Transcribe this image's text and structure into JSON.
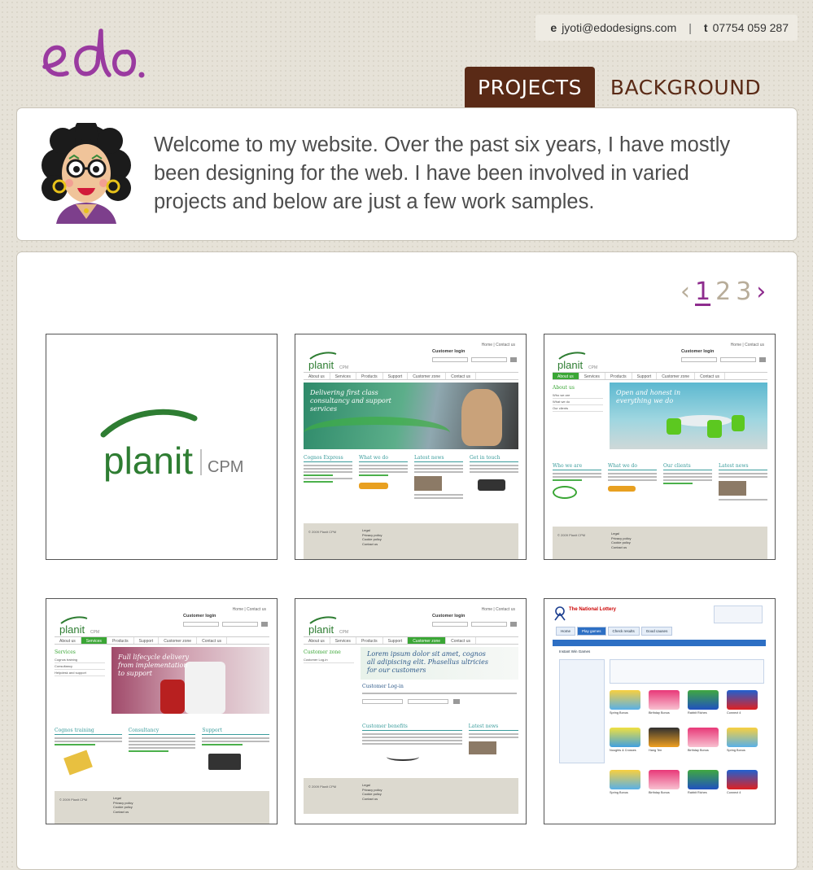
{
  "brand": {
    "logo_text": "edo."
  },
  "contact": {
    "email_label": "e",
    "email": "jyoti@edodesigns.com",
    "separator": "|",
    "phone_label": "t",
    "phone": "07754 059 287"
  },
  "nav": {
    "projects_label": "PROJECTS",
    "background_label": "BACKGROUND"
  },
  "welcome": {
    "text": "Welcome to my website. Over the past six years, I have mostly been designing for the web. I have been involved in varied projects and below are just a few work samples."
  },
  "pagination": {
    "prev_icon": "chevron-left-icon",
    "next_icon": "chevron-right-icon",
    "pages": [
      "1",
      "2",
      "3"
    ],
    "current": "1"
  },
  "thumbnails": [
    {
      "kind": "logo",
      "logo_main": "planit",
      "logo_sub": "CPM"
    },
    {
      "kind": "site",
      "logo_main": "planit",
      "logo_sub": "CPM",
      "top_links": "Home  |  Contact us",
      "login_label": "Customer login",
      "nav": [
        "About us",
        "Services",
        "Products",
        "Support",
        "Customer zone",
        "Contact us"
      ],
      "active_nav": "",
      "hero_caption": "Delivering first class consultancy and support services",
      "columns": [
        "Cognos Express",
        "What we do",
        "Latest news",
        "Get in touch"
      ],
      "footer_left": "© 2009 Planit CPM",
      "footer_links": [
        "Legal",
        "Privacy policy",
        "Cookie policy",
        "Contact us"
      ]
    },
    {
      "kind": "site-side",
      "logo_main": "planit",
      "logo_sub": "CPM",
      "top_links": "Home  |  Contact us",
      "login_label": "Customer login",
      "nav": [
        "About us",
        "Services",
        "Products",
        "Support",
        "Customer zone",
        "Contact us"
      ],
      "active_nav": "About us",
      "side_title": "About us",
      "side_items": [
        "Who we are",
        "What we do",
        "Our clients"
      ],
      "hero_caption": "Open and honest in everything we do",
      "columns": [
        "Who we are",
        "What we do",
        "Our clients",
        "Latest news"
      ],
      "footer_left": "© 2009 Planit CPM",
      "footer_links": [
        "Legal",
        "Privacy policy",
        "Cookie policy",
        "Contact us"
      ]
    },
    {
      "kind": "site-side",
      "logo_main": "planit",
      "logo_sub": "CPM",
      "top_links": "Home  |  Contact us",
      "login_label": "Customer login",
      "nav": [
        "About us",
        "Services",
        "Products",
        "Support",
        "Customer zone",
        "Contact us"
      ],
      "active_nav": "Services",
      "side_title": "Services",
      "side_items": [
        "Cognos training",
        "Consultancy",
        "Helpdesk and support"
      ],
      "hero_caption": "Full lifecycle delivery from implementation to support",
      "columns": [
        "Cognos training",
        "Consultancy",
        "Support"
      ],
      "footer_left": "© 2009 Planit CPM",
      "footer_links": [
        "Legal",
        "Privacy policy",
        "Cookie policy",
        "Contact us"
      ]
    },
    {
      "kind": "site-side",
      "logo_main": "planit",
      "logo_sub": "CPM",
      "top_links": "Home  |  Contact us",
      "login_label": "Customer login",
      "nav": [
        "About us",
        "Services",
        "Products",
        "Support",
        "Customer zone",
        "Contact us"
      ],
      "active_nav": "Customer zone",
      "side_title": "Customer zone",
      "side_items": [
        "Customer Log-in"
      ],
      "hero_caption": "Lorem ipsum dolor sit amet, cognos all adipiscing elit. Phasellus ultricies for our customers",
      "columns": [
        "Customer benefits",
        "Latest news"
      ],
      "footer_left": "© 2009 Planit CPM",
      "footer_links": [
        "Legal",
        "Privacy policy",
        "Cookie policy",
        "Contact us"
      ]
    },
    {
      "kind": "lottery",
      "title": "The National Lottery",
      "tabs": [
        "Home",
        "Play games",
        "Check results",
        "Good causes"
      ],
      "active_tab": "Play games",
      "section": "Instant Win Games",
      "games": [
        "Spring Bonus",
        "Birthday Bonus",
        "Rabbit Riches",
        "Connect 4",
        "Noughts & Crosses",
        "Hang Ten",
        "Birthday Bonus",
        "Spring Bonus",
        "Spring Bonus",
        "Birthday Bonus",
        "Rabbit Riches",
        "Connect 4"
      ]
    }
  ],
  "colors": {
    "brand_purple": "#8e2c8e",
    "tab_brown": "#5a2a16",
    "planit_green": "#2e7d32",
    "page_bg": "#e6e2d8"
  }
}
